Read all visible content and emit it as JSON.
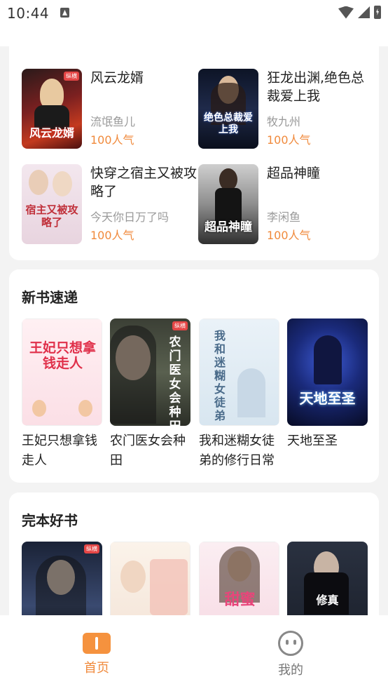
{
  "status_bar": {
    "time": "10:44"
  },
  "hot_grid": [
    {
      "title": "风云龙婿",
      "author": "流氓鱼儿",
      "popularity": "100人气",
      "cover_text": "风云龙婿"
    },
    {
      "title": "狂龙出渊,绝色总裁爱上我",
      "author": "牧九州",
      "popularity": "100人气",
      "cover_text": "绝色总裁爱上我"
    },
    {
      "title": "快穿之宿主又被攻略了",
      "author": "今天你日万了吗",
      "popularity": "100人气",
      "cover_text": "宿主又被攻略了"
    },
    {
      "title": "超品神瞳",
      "author": "李闲鱼",
      "popularity": "100人气",
      "cover_text": "超品神瞳"
    }
  ],
  "new_books": {
    "title": "新书速递",
    "items": [
      {
        "title": "王妃只想拿钱走人",
        "cover_text": "王妃只想拿钱走人"
      },
      {
        "title": "农门医女会种田",
        "cover_text": "农门医女会种田"
      },
      {
        "title": "我和迷糊女徒弟的修行日常",
        "cover_text": "我和迷糊女徒弟"
      },
      {
        "title": "天地至圣",
        "cover_text": "天地至圣"
      }
    ]
  },
  "complete_books": {
    "title": "完本好书",
    "items": [
      {
        "title": "",
        "cover_text": ""
      },
      {
        "title": "",
        "cover_text": ""
      },
      {
        "title": "",
        "cover_text": "甜蜜"
      },
      {
        "title": "",
        "cover_text": "修真"
      }
    ]
  },
  "tab_bar": {
    "home_label": "首页",
    "mine_label": "我的"
  },
  "colors": {
    "accent": "#f08a3c",
    "muted": "#999999",
    "background": "#f3f3f3"
  }
}
